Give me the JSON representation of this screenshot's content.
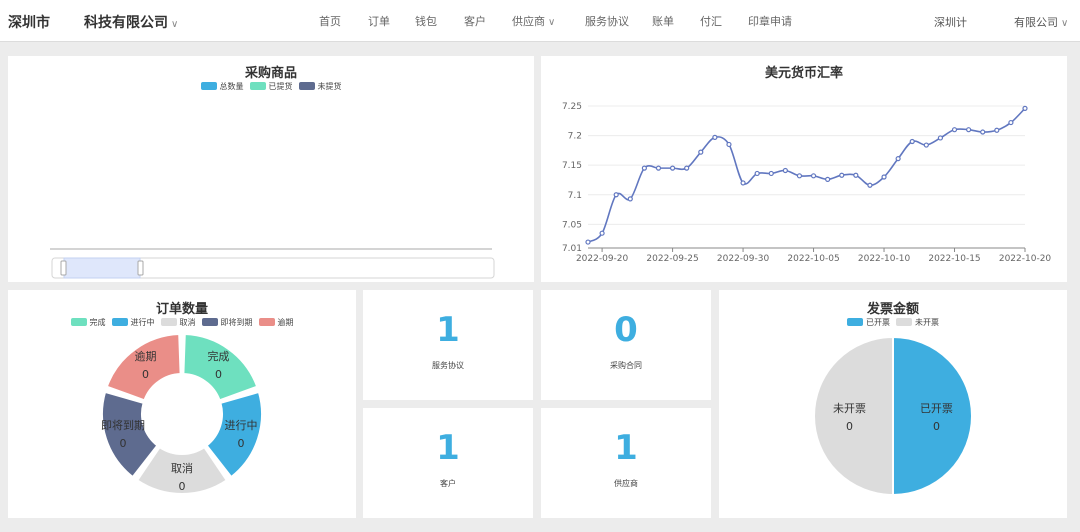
{
  "header": {
    "city": "深圳市",
    "company": "科技有限公司",
    "nav": [
      {
        "label": "首页",
        "dropdown": false
      },
      {
        "label": "订单",
        "dropdown": false
      },
      {
        "label": "钱包",
        "dropdown": false
      },
      {
        "label": "客户",
        "dropdown": false
      },
      {
        "label": "供应商",
        "dropdown": true
      },
      {
        "label": "服务协议",
        "dropdown": false
      },
      {
        "label": "账单",
        "dropdown": false
      },
      {
        "label": "付汇",
        "dropdown": false
      },
      {
        "label": "印章申请",
        "dropdown": false
      }
    ],
    "region": "深圳计",
    "account": "有限公司"
  },
  "purchase": {
    "title": "采购商品",
    "legend": [
      {
        "label": "总数量",
        "color": "#3eaee0"
      },
      {
        "label": "已提货",
        "color": "#6ee0bf"
      },
      {
        "label": "未提货",
        "color": "#5e6b8f"
      }
    ]
  },
  "exchange": {
    "title": "美元货币汇率"
  },
  "orders": {
    "title": "订单数量",
    "legend": [
      {
        "label": "完成",
        "color": "#6ee0bf"
      },
      {
        "label": "进行中",
        "color": "#3eaee0"
      },
      {
        "label": "取消",
        "color": "#dcdcdc"
      },
      {
        "label": "即将到期",
        "color": "#5e6b8f"
      },
      {
        "label": "逾期",
        "color": "#ea8e88"
      }
    ]
  },
  "stats": [
    {
      "value": "1",
      "label": "服务协议"
    },
    {
      "value": "0",
      "label": "采购合同"
    },
    {
      "value": "1",
      "label": "客户"
    },
    {
      "value": "1",
      "label": "供应商"
    }
  ],
  "invoice": {
    "title": "发票金额",
    "legend": [
      {
        "label": "已开票",
        "color": "#3eaee0"
      },
      {
        "label": "未开票",
        "color": "#dcdcdc"
      }
    ]
  },
  "chart_data": [
    {
      "type": "line",
      "title": "美元货币汇率",
      "ylim": [
        7.01,
        7.25
      ],
      "y_ticks": [
        "7.25",
        "7.2",
        "7.15",
        "7.1",
        "7.05",
        "7.01"
      ],
      "x_ticks": [
        "2022-09-20",
        "2022-09-25",
        "2022-09-30",
        "2022-10-05",
        "2022-10-10",
        "2022-10-15",
        "2022-10-20"
      ],
      "x_range": [
        "2022-09-19",
        "2022-10-20"
      ],
      "grid": true,
      "series": [
        {
          "color": "#6177c0",
          "points": [
            [
              "2022-09-19",
              7.02
            ],
            [
              "2022-09-20",
              7.035
            ],
            [
              "2022-09-21",
              7.1
            ],
            [
              "2022-09-22",
              7.093
            ],
            [
              "2022-09-23",
              7.145
            ],
            [
              "2022-09-24",
              7.145
            ],
            [
              "2022-09-25",
              7.145
            ],
            [
              "2022-09-26",
              7.145
            ],
            [
              "2022-09-27",
              7.172
            ],
            [
              "2022-09-28",
              7.197
            ],
            [
              "2022-09-29",
              7.185
            ],
            [
              "2022-09-30",
              7.12
            ],
            [
              "2022-10-01",
              7.136
            ],
            [
              "2022-10-02",
              7.136
            ],
            [
              "2022-10-03",
              7.141
            ],
            [
              "2022-10-04",
              7.132
            ],
            [
              "2022-10-05",
              7.132
            ],
            [
              "2022-10-06",
              7.126
            ],
            [
              "2022-10-07",
              7.133
            ],
            [
              "2022-10-08",
              7.133
            ],
            [
              "2022-10-09",
              7.116
            ],
            [
              "2022-10-10",
              7.13
            ],
            [
              "2022-10-11",
              7.161
            ],
            [
              "2022-10-12",
              7.19
            ],
            [
              "2022-10-13",
              7.184
            ],
            [
              "2022-10-14",
              7.196
            ],
            [
              "2022-10-15",
              7.21
            ],
            [
              "2022-10-16",
              7.21
            ],
            [
              "2022-10-17",
              7.206
            ],
            [
              "2022-10-18",
              7.209
            ],
            [
              "2022-10-19",
              7.222
            ],
            [
              "2022-10-20",
              7.246
            ]
          ]
        }
      ]
    },
    {
      "type": "pie",
      "title": "订单数量",
      "donut": true,
      "slices": [
        {
          "label": "完成",
          "value": 0,
          "color": "#6ee0bf"
        },
        {
          "label": "进行中",
          "value": 0,
          "color": "#3eaee0"
        },
        {
          "label": "取消",
          "value": 0,
          "color": "#dcdcdc"
        },
        {
          "label": "即将到期",
          "value": 0,
          "color": "#5e6b8f"
        },
        {
          "label": "逾期",
          "value": 0,
          "color": "#ea8e88"
        }
      ]
    },
    {
      "type": "pie",
      "title": "发票金额",
      "donut": false,
      "slices": [
        {
          "label": "已开票",
          "value": 0,
          "color": "#3eaee0"
        },
        {
          "label": "未开票",
          "value": 0,
          "color": "#dcdcdc"
        }
      ]
    }
  ]
}
